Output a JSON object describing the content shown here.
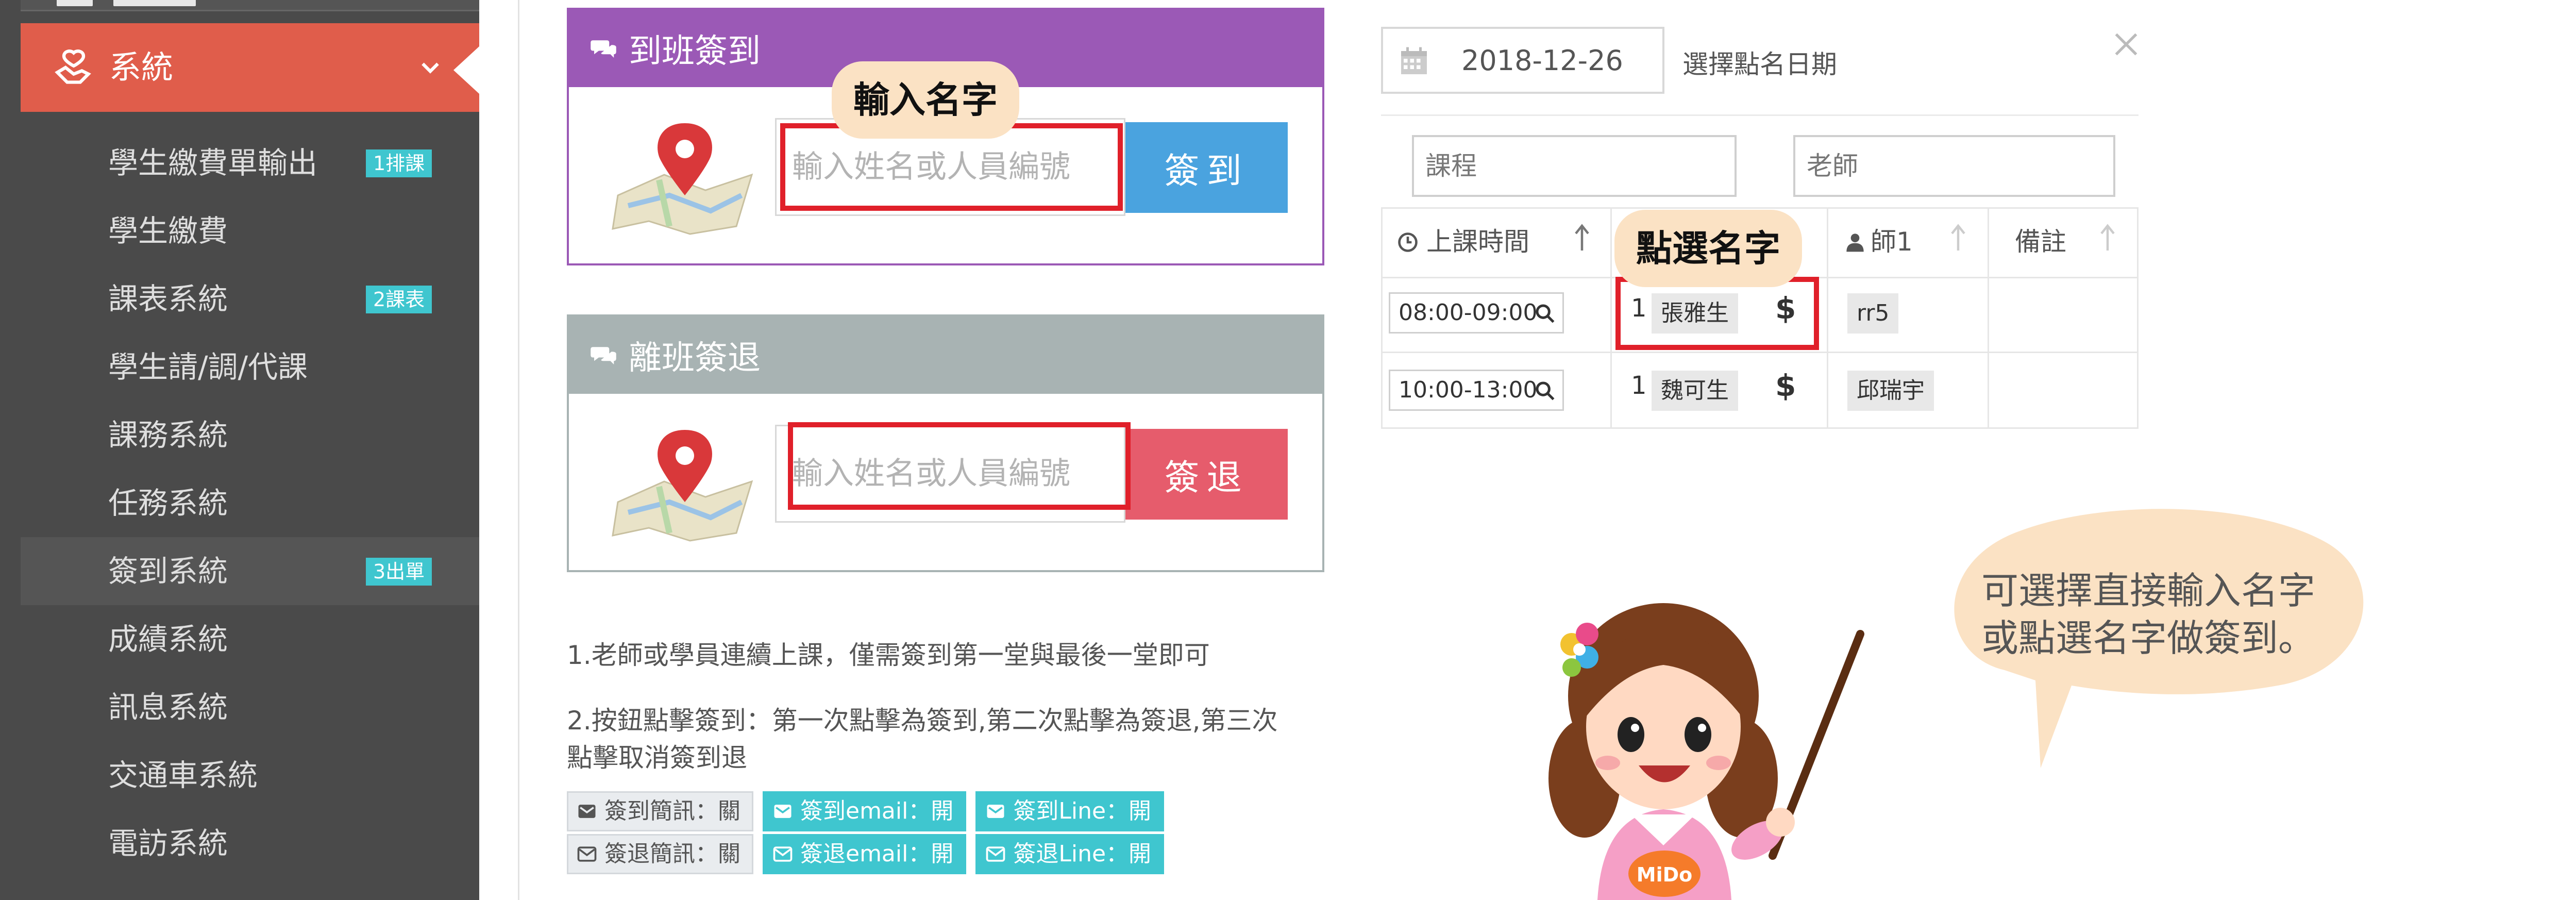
{
  "sidebar": {
    "active": {
      "label": "系統"
    },
    "items": [
      {
        "label": "學生繳費單輸出",
        "badge": "1排課"
      },
      {
        "label": "學生繳費",
        "badge": ""
      },
      {
        "label": "課表系統",
        "badge": "2課表"
      },
      {
        "label": "學生請/調/代課",
        "badge": ""
      },
      {
        "label": "課務系統",
        "badge": ""
      },
      {
        "label": "任務系統",
        "badge": ""
      },
      {
        "label": "簽到系統",
        "badge": "3出單"
      },
      {
        "label": "成績系統",
        "badge": ""
      },
      {
        "label": "訊息系統",
        "badge": ""
      },
      {
        "label": "交通車系統",
        "badge": ""
      },
      {
        "label": "電訪系統",
        "badge": ""
      }
    ]
  },
  "checkin": {
    "title": "到班簽到",
    "placeholder": "輸入姓名或人員編號",
    "button": "簽到"
  },
  "checkout": {
    "title": "離班簽退",
    "placeholder": "輸入姓名或人員編號",
    "button": "簽退"
  },
  "callouts": {
    "enter_name": "輸入名字",
    "select_name": "點選名字"
  },
  "notes": {
    "note1": "1.老師或學員連續上課，僅需簽到第一堂與最後一堂即可",
    "note2_line1": "2.按鈕點擊簽到：第一次點擊為簽到,第二次點擊為簽退,第三次",
    "note2_line2": "點擊取消簽到退"
  },
  "notices": {
    "row1": [
      {
        "label": "簽到簡訊：關",
        "on": false
      },
      {
        "label": "簽到email：開",
        "on": true
      },
      {
        "label": "簽到Line：開",
        "on": true
      }
    ],
    "row2": [
      {
        "label": "簽退簡訊：關",
        "on": false
      },
      {
        "label": "簽退email：開",
        "on": true
      },
      {
        "label": "簽退Line：開",
        "on": true
      }
    ]
  },
  "date": {
    "value": "2018-12-26",
    "label": "選擇點名日期"
  },
  "filters": {
    "course_placeholder": "課程",
    "teacher_placeholder": "老師"
  },
  "table": {
    "headers": [
      "上課時間",
      "",
      "師1",
      "備註"
    ],
    "rows": [
      {
        "time": "08:00-09:00",
        "num": "1",
        "student": "張雅生",
        "dollar": "$",
        "teacher": "rr5"
      },
      {
        "time": "10:00-13:00",
        "num": "1",
        "student": "魏可生",
        "dollar": "$",
        "teacher": "邱瑞宇"
      }
    ]
  },
  "speech": {
    "line1": "可選擇直接輸入名字",
    "line2": "或點選名字做簽到。"
  },
  "mascot": {
    "badge": "MiDo"
  },
  "colors": {
    "sidebar_bg": "#4a4a4a",
    "sidebar_active": "#e05d4b",
    "badge": "#3fc6cf",
    "checkin_head": "#9b59b6",
    "checkout_head": "#a8b3b3",
    "checkin_btn": "#4aa3df",
    "checkout_btn": "#e65c6c",
    "highlight": "#e0202a",
    "callout_bg": "#fbe2c4"
  }
}
